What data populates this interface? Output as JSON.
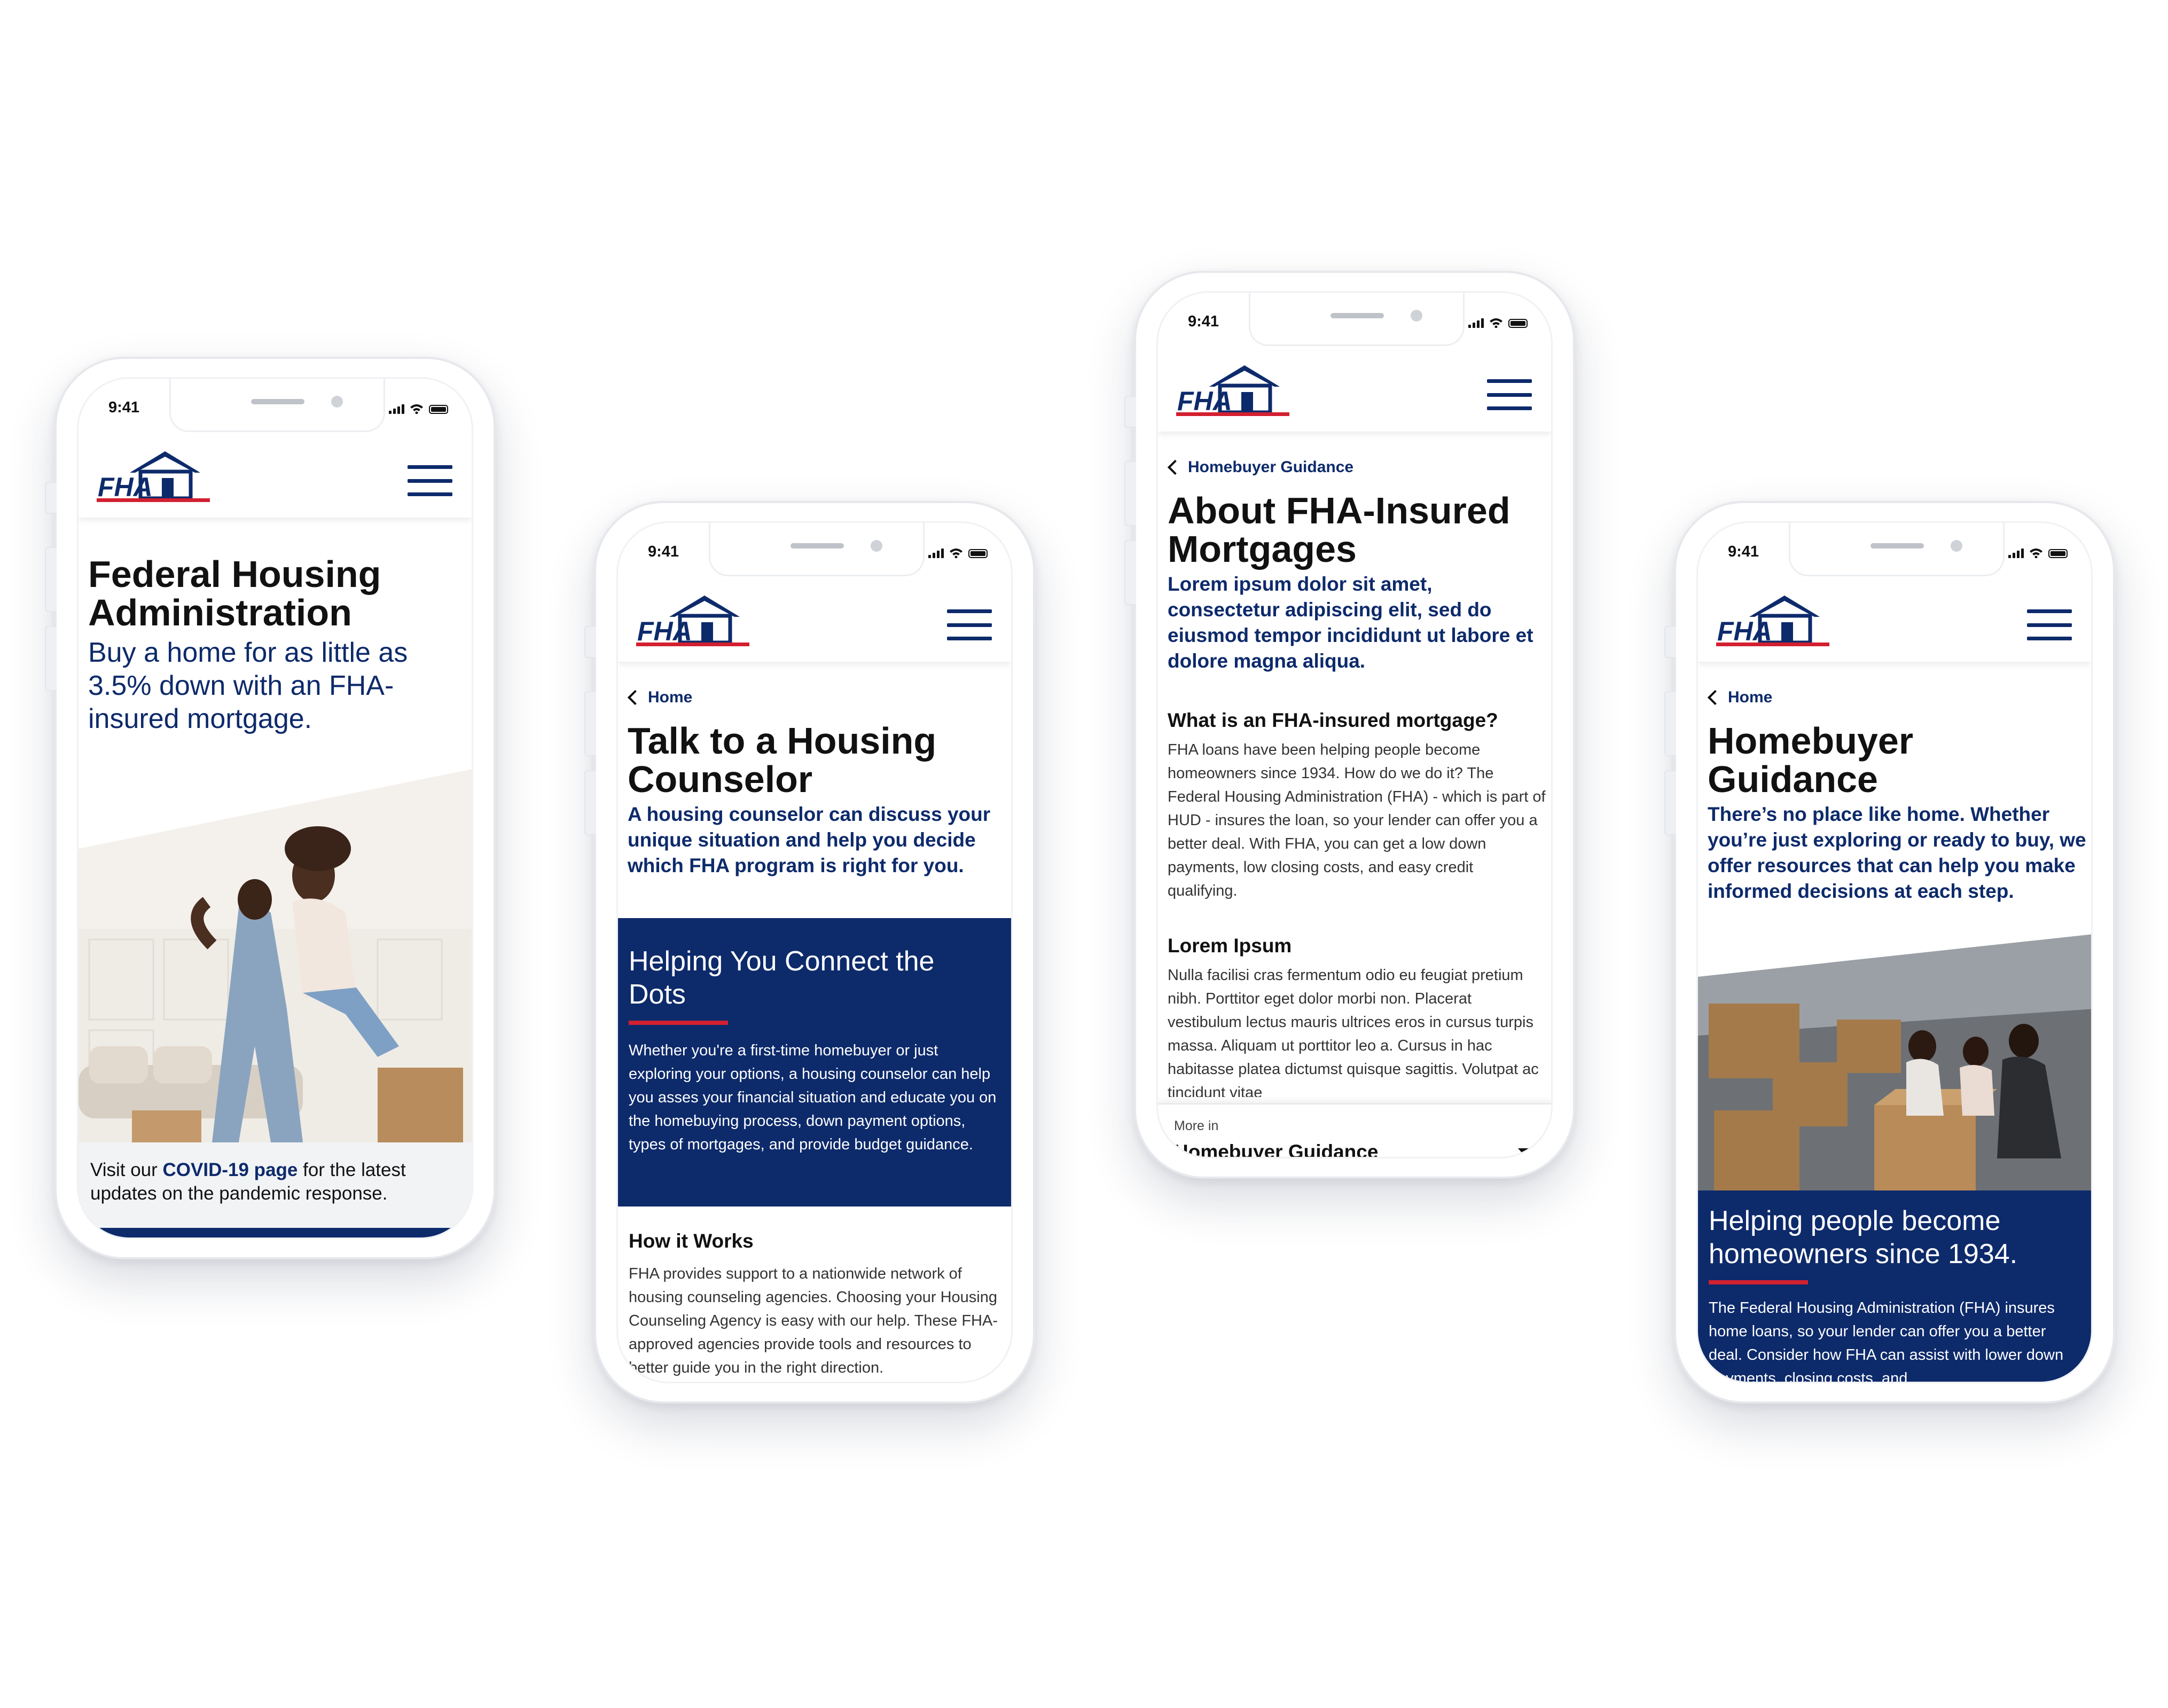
{
  "status": {
    "time": "9:41"
  },
  "brand": {
    "logo_text": "FHA",
    "navy": "#0d2a6b",
    "red": "#d22030"
  },
  "phone1": {
    "title": "Federal Housing Administration",
    "subtitle": "Buy a home for as little as 3.5% down with an FHA-insured mortgage.",
    "covid_prefix": "Visit our ",
    "covid_link": "COVID-19 page",
    "covid_suffix": " for the latest updates on the pandemic response."
  },
  "phone2": {
    "breadcrumb": "Home",
    "title": "Talk to a Housing Counselor",
    "lead": "A housing counselor can discuss your unique situation and help you decide which FHA program is right for you.",
    "panel_title": "Helping You Connect the Dots",
    "panel_body": "Whether you're a first-time homebuyer or just exploring your options, a housing counselor can help you asses your financial situation and educate you on the homebuying process, down payment options, types of mortgages, and provide budget guidance.",
    "section_title": "How it Works",
    "section_body": "FHA provides support to a nationwide network of housing counseling agencies. Choosing your Housing Counseling Agency is easy with our help. These FHA-approved agencies provide tools and resources to better guide you in the right direction."
  },
  "phone3": {
    "breadcrumb": "Homebuyer Guidance",
    "title": "About FHA-Insured Mortgages",
    "lead": "Lorem ipsum dolor sit amet, consectetur adipiscing elit, sed do eiusmod tempor incididunt ut labore et dolore magna aliqua.",
    "q1_title": "What is an FHA-insured mortgage?",
    "q1_body": "FHA loans have been helping people become homeowners since 1934. How do we do it? The Federal Housing Administration (FHA) - which is part of HUD - insures the loan, so your lender can offer you a better deal. With FHA, you can get a low down payments, low closing costs, and easy credit qualifying.",
    "q2_title": "Lorem Ipsum",
    "q2_body": "Nulla facilisi cras fermentum odio eu feugiat pretium nibh. Porttitor eget dolor morbi non. Placerat vestibulum lectus mauris ultrices eros in cursus turpis massa. Aliquam ut porttitor leo a. Cursus in hac habitasse platea dictumst quisque sagittis. Volutpat ac tincidunt vitae",
    "more_label": "More in",
    "more_value": "Homebuyer Guidance"
  },
  "phone4": {
    "breadcrumb": "Home",
    "title": "Homebuyer Guidance",
    "lead": "There’s no place like home. Whether you’re just exploring or ready to buy, we offer resources that can help you make informed decisions at each step.",
    "panel_title": "Helping people become homeowners since 1934.",
    "panel_body": "The Federal Housing Administration (FHA) insures home loans, so your lender can offer you a better deal. Consider how FHA can assist with lower down payments, closing costs, and"
  }
}
